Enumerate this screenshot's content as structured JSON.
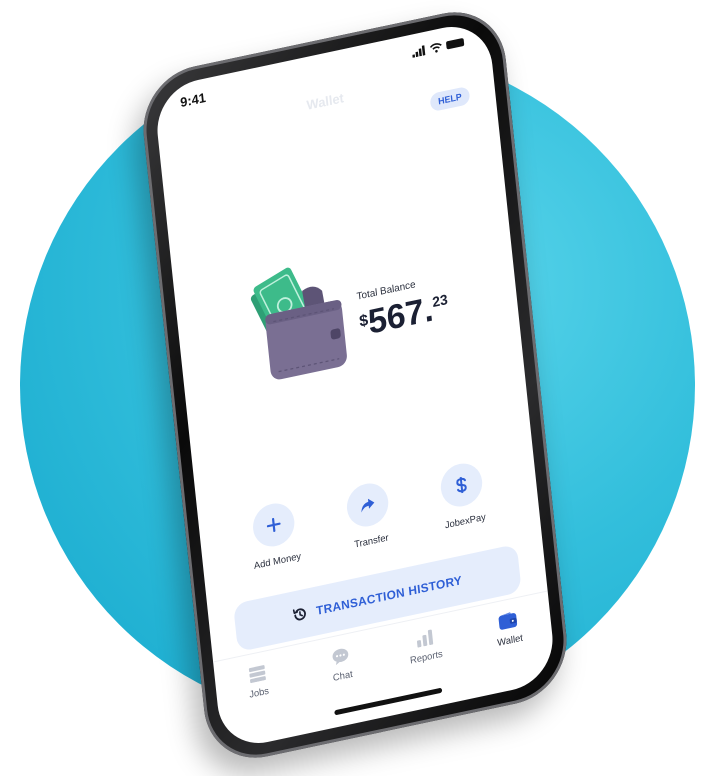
{
  "status_bar": {
    "time": "9:41"
  },
  "header": {
    "title": "Wallet",
    "help_label": "HELP"
  },
  "balance": {
    "label": "Total Balance",
    "currency": "$",
    "whole": "567",
    "separator": ".",
    "cents": "23"
  },
  "actions": [
    {
      "label": "Add Money",
      "icon": "plus-icon"
    },
    {
      "label": "Transfer",
      "icon": "share-arrow-icon"
    },
    {
      "label": "JobexPay",
      "icon": "dollar-icon"
    }
  ],
  "history_button": {
    "label": "TRANSACTION HISTORY",
    "icon": "history-icon"
  },
  "tabs": [
    {
      "label": "Jobs",
      "icon": "jobs-icon",
      "active": false
    },
    {
      "label": "Chat",
      "icon": "chat-icon",
      "active": false
    },
    {
      "label": "Reports",
      "icon": "reports-icon",
      "active": false
    },
    {
      "label": "Wallet",
      "icon": "wallet-icon",
      "active": true
    }
  ],
  "colors": {
    "accent": "#2f5fd6",
    "accent_light": "#e5edfc",
    "background_circle": "#33bfdc",
    "wallet_purple": "#7a6f93",
    "cash_green": "#3dbb8a"
  }
}
